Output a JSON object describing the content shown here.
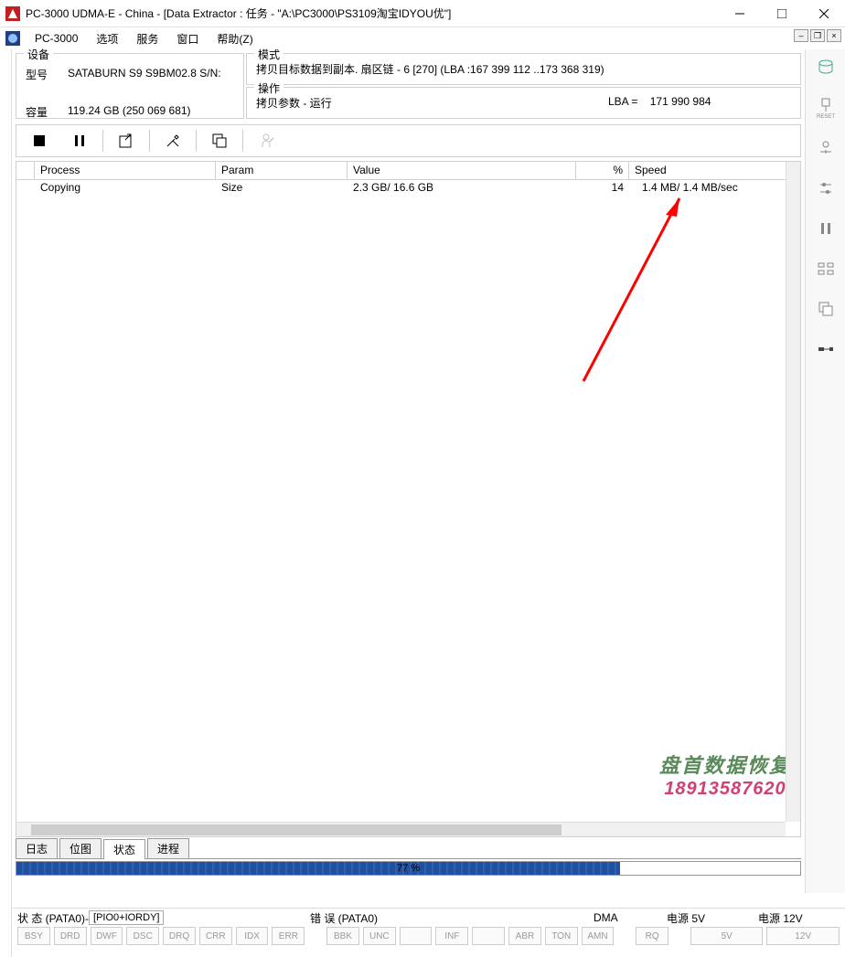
{
  "window": {
    "title": "PC-3000 UDMA-E - China - [Data Extractor : 任务 - \"A:\\PC3000\\PS3109淘宝IDYOU优\"]"
  },
  "menu": {
    "app": "PC-3000",
    "items": [
      "选项",
      "服务",
      "窗口",
      "帮助(Z)"
    ]
  },
  "device": {
    "legend": "设备",
    "model_label": "型号",
    "model_value": "SATABURN   S9 S9BM02.8 S/N:",
    "capacity_label": "容量",
    "capacity_value": "119.24 GB (250 069 681)"
  },
  "mode": {
    "legend": "模式",
    "text": "拷贝目标数据到副本.  扇区链 - 6 [270] (LBA :167 399 112 ..173 368 319)"
  },
  "operation": {
    "legend": "操作",
    "text": "拷贝参数 - 运行",
    "lba_label": "LBA  =",
    "lba_value": "171 990 984"
  },
  "grid": {
    "headers": [
      "",
      "Process",
      "Param",
      "Value",
      "%",
      "Speed"
    ],
    "row": {
      "process": "Copying",
      "param": "Size",
      "value": "2.3 GB/ 16.6 GB",
      "percent": "14",
      "speed": "1.4 MB/ 1.4 MB/sec"
    }
  },
  "tabs": [
    "日志",
    "位图",
    "状态",
    "进程"
  ],
  "progress": {
    "percent": 77,
    "label": "77 %"
  },
  "status": {
    "state_label": "状 态 (PATA0)-",
    "state_value": "[PIO0+IORDY]",
    "error_label": "错 误 (PATA0)",
    "dma_label": "DMA",
    "power5": "电源 5V",
    "power12": "电源 12V",
    "cells1": [
      "BSY",
      "DRD",
      "DWF",
      "DSC",
      "DRQ",
      "CRR",
      "IDX",
      "ERR"
    ],
    "cells2": [
      "BBK",
      "UNC",
      "",
      "INF",
      "",
      "ABR",
      "TON",
      "AMN"
    ],
    "cells3": [
      "RQ"
    ],
    "cells4": [
      "5V"
    ],
    "cells5": [
      "12V"
    ]
  },
  "watermark": {
    "line1": "盘首数据恢复",
    "line2": "18913587620"
  },
  "right_icons": [
    "db",
    "reset",
    "slider",
    "slider2",
    "pause",
    "props",
    "copy",
    "other"
  ]
}
